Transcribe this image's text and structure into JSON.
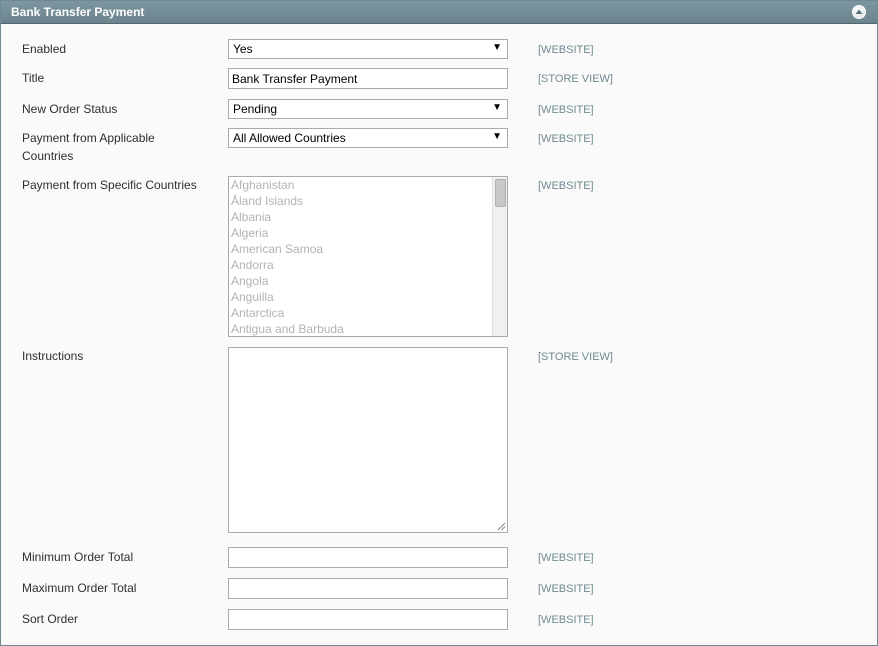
{
  "panel": {
    "title": "Bank Transfer Payment"
  },
  "fields": {
    "enabled": {
      "label": "Enabled",
      "value": "Yes",
      "scope": "[WEBSITE]"
    },
    "title": {
      "label": "Title",
      "value": "Bank Transfer Payment",
      "scope": "[STORE VIEW]"
    },
    "new_order_status": {
      "label": "New Order Status",
      "value": "Pending",
      "scope": "[WEBSITE]"
    },
    "applicable_countries": {
      "label_line1": "Payment from Applicable",
      "label_line2": "Countries",
      "value": "All Allowed Countries",
      "scope": "[WEBSITE]"
    },
    "specific_countries": {
      "label": "Payment from Specific Countries",
      "scope": "[WEBSITE]",
      "options": [
        "Afghanistan",
        "Åland Islands",
        "Albania",
        "Algeria",
        "American Samoa",
        "Andorra",
        "Angola",
        "Anguilla",
        "Antarctica",
        "Antigua and Barbuda"
      ]
    },
    "instructions": {
      "label": "Instructions",
      "value": "",
      "scope": "[STORE VIEW]"
    },
    "min_order_total": {
      "label": "Minimum Order Total",
      "value": "",
      "scope": "[WEBSITE]"
    },
    "max_order_total": {
      "label": "Maximum Order Total",
      "value": "",
      "scope": "[WEBSITE]"
    },
    "sort_order": {
      "label": "Sort Order",
      "value": "",
      "scope": "[WEBSITE]"
    }
  },
  "icons": {
    "collapse": "chevron-up-icon",
    "dropdown": "dropdown-arrow-icon",
    "resize": "resize-grip-icon"
  },
  "colors": {
    "header_bg": "#6f8992",
    "scope_text": "#6f8992",
    "disabled_text": "#b3b3b3"
  }
}
